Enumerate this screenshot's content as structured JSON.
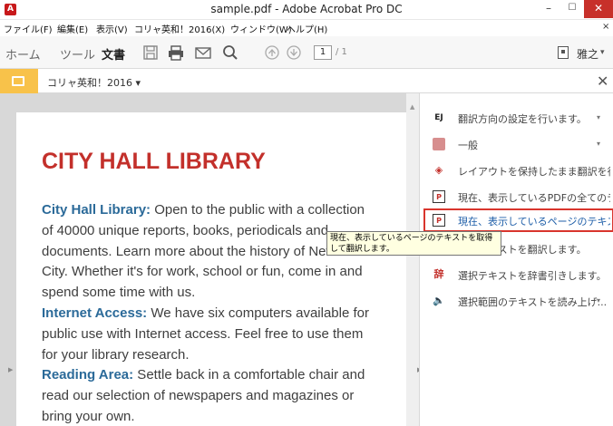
{
  "window": {
    "title": "sample.pdf - Adobe Acrobat Pro DC",
    "app_icon_letter": "A",
    "min_glyph": "–",
    "max_glyph": "☐",
    "close_glyph": "✕"
  },
  "menubar": {
    "items": [
      "ファイル(F)",
      "編集(E)",
      "表示(V)",
      "コリャ英和！2016(X)",
      "ウィンドウ(W)",
      "ヘルプ(H)"
    ],
    "close_glyph": "×"
  },
  "toolbar": {
    "tabs": [
      "ホーム",
      "ツール",
      "文書"
    ],
    "active_tab": "文書",
    "page_current": "1",
    "page_total": "/ 1",
    "user_name": "雅之",
    "user_chevron": "▾"
  },
  "pluginbar": {
    "label": "コリャ英和！2016 ▾",
    "close_glyph": "✕"
  },
  "document": {
    "title": "CITY HALL LIBRARY",
    "lines": [
      {
        "hl": "City Hall Library:",
        "text": " Open to the public with a collection"
      },
      {
        "hl": "",
        "text": "of 40000 unique reports, books, periodicals and"
      },
      {
        "hl": "",
        "text": "documents. Learn more about the history of New York"
      },
      {
        "hl": "",
        "text": "City. Whether it's for work, school or fun, come in and"
      },
      {
        "hl": "",
        "text": "spend some time with us."
      },
      {
        "hl": "Internet Access:",
        "text": " We have six computers available for"
      },
      {
        "hl": "",
        "text": "public use with Internet access. Feel free to use them"
      },
      {
        "hl": "",
        "text": "for your library research."
      },
      {
        "hl": "Reading Area:",
        "text": " Settle back in a comfortable chair and"
      },
      {
        "hl": "",
        "text": "read our selection of newspapers and magazines or"
      },
      {
        "hl": "",
        "text": "bring your own."
      }
    ]
  },
  "panel": {
    "items": [
      {
        "icon": "EJ",
        "icon_name": "translate-direction-icon",
        "label": "翻訳方向の設定を行います。",
        "chevron": "▾"
      },
      {
        "icon": "",
        "icon_name": "general-settings-icon",
        "label": "一般",
        "chevron": "▾"
      },
      {
        "icon": "◈",
        "icon_name": "layout-translate-icon",
        "label": "レイアウトを保持したまま翻訳を行...",
        "chevron": ""
      },
      {
        "icon": "P",
        "icon_name": "pdf-all-text-icon",
        "label": "現在、表示しているPDFの全てのテ...",
        "chevron": ""
      },
      {
        "icon": "P",
        "icon_name": "page-text-translate-icon",
        "label": "現在、表示しているページのテキス...",
        "chevron": "",
        "selected": true
      },
      {
        "icon": "P",
        "icon_name": "selected-text-translate-icon",
        "label": "選択テキストを翻訳します。",
        "chevron": ""
      },
      {
        "icon": "辞",
        "icon_name": "dictionary-lookup-icon",
        "label": "選択テキストを辞書引きします。",
        "chevron": ""
      },
      {
        "icon": "🔈",
        "icon_name": "read-aloud-icon",
        "label": "選択範囲のテキストを読み上げ...",
        "chevron": "▾"
      }
    ]
  },
  "tooltip": {
    "text": "現在、表示しているページのテキストを取得して翻訳します。"
  }
}
